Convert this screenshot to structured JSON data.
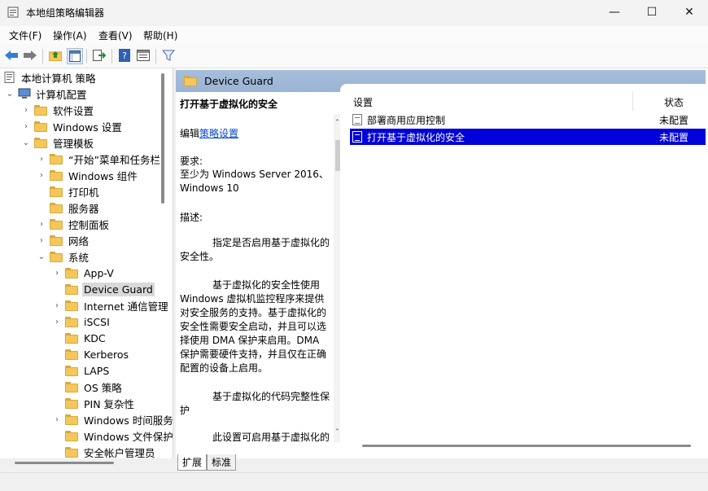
{
  "window": {
    "title": "本地组策略编辑器",
    "controls": {
      "minimize": "—",
      "maximize": "☐",
      "close": "✕"
    }
  },
  "menu": [
    "文件(F)",
    "操作(A)",
    "查看(V)",
    "帮助(H)"
  ],
  "tree": {
    "root": "本地计算机 策略",
    "items": [
      "计算机配置",
      "软件设置",
      "Windows 设置",
      "管理模板",
      "“开始”菜单和任务栏",
      "Windows 组件",
      "打印机",
      "服务器",
      "控制面板",
      "网络",
      "系统",
      "App-V",
      "Device Guard",
      "Internet 通信管理",
      "iSCSI",
      "KDC",
      "Kerberos",
      "LAPS",
      "OS 策略",
      "PIN 复杂性",
      "Windows 时间服务",
      "Windows 文件保护",
      "安全帐户管理员"
    ]
  },
  "header": {
    "title": "Device Guard"
  },
  "description": {
    "title": "打开基于虚拟化的安全",
    "edit_prefix": "编辑",
    "edit_link": "策略设置",
    "req_label": "要求:",
    "req_text": "至少为 Windows Server 2016、Windows 10",
    "desc_label": "描述:",
    "para1": "指定是否启用基于虚拟化的安全性。",
    "para2": "基于虚拟化的安全性使用 Windows 虚拟机监控程序来提供对安全服务的支持。基于虚拟化的安全性需要安全启动，并且可以选择使用 DMA 保护来启用。DMA 保护需要硬件支持，并且仅在正确配置的设备上启用。",
    "para3": "基于虚拟化的代码完整性保护",
    "para4": "此设置可启用基于虚拟化的内核模式代码完整性保护。启用此"
  },
  "list": {
    "columns": {
      "setting": "设置",
      "state": "状态"
    },
    "rows": [
      {
        "name": "部署商用应用控制",
        "state": "未配置"
      },
      {
        "name": "打开基于虚拟化的安全",
        "state": "未配置"
      }
    ]
  },
  "tabs": [
    "扩展",
    "标准"
  ]
}
